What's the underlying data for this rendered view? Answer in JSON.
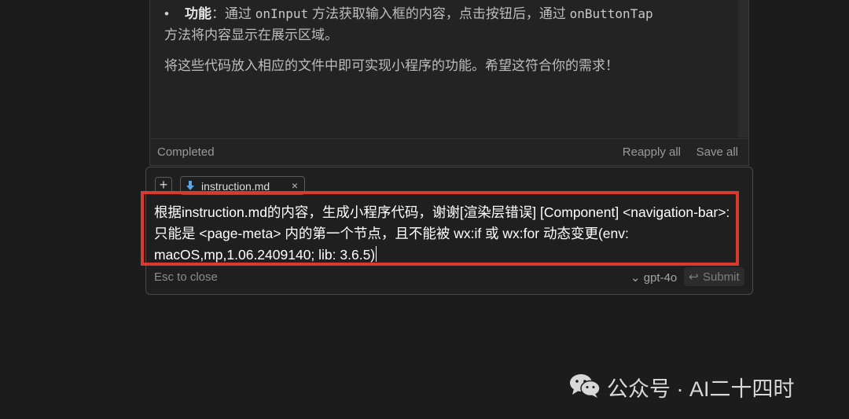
{
  "response": {
    "bullet_label": "功能",
    "bullet_sep": "：通过 ",
    "code1": "onInput",
    "bullet_mid": " 方法获取输入框的内容，点击按钮后，通过 ",
    "code2": "onButtonTap",
    "bullet_cont": "方法将内容显示在展示区域。",
    "closing": "将这些代码放入相应的文件中即可实现小程序的功能。希望这符合你的需求！"
  },
  "status": {
    "text": "Completed",
    "reapply_label": "Reapply all",
    "saveall_label": "Save all"
  },
  "composer": {
    "plus": "+",
    "file_chip": "instruction.md",
    "file_chip_close": "×",
    "prompt": "根据instruction.md的内容，生成小程序代码，谢谢[渲染层错误] [Component] <navigation-bar>: 只能是 <page-meta> 内的第一个节点，且不能被 wx:if 或 wx:for 动态变更(env: macOS,mp,1.06.2409140; lib: 3.6.5)",
    "esc_hint": "Esc to close",
    "model": "⌄ gpt-4o",
    "submit_icon": "↩",
    "submit_label": "Submit"
  },
  "watermark": {
    "text": "公众号 · AI二十四时"
  },
  "colors": {
    "highlight": "#d83a2e",
    "background": "#1c1c1c"
  }
}
